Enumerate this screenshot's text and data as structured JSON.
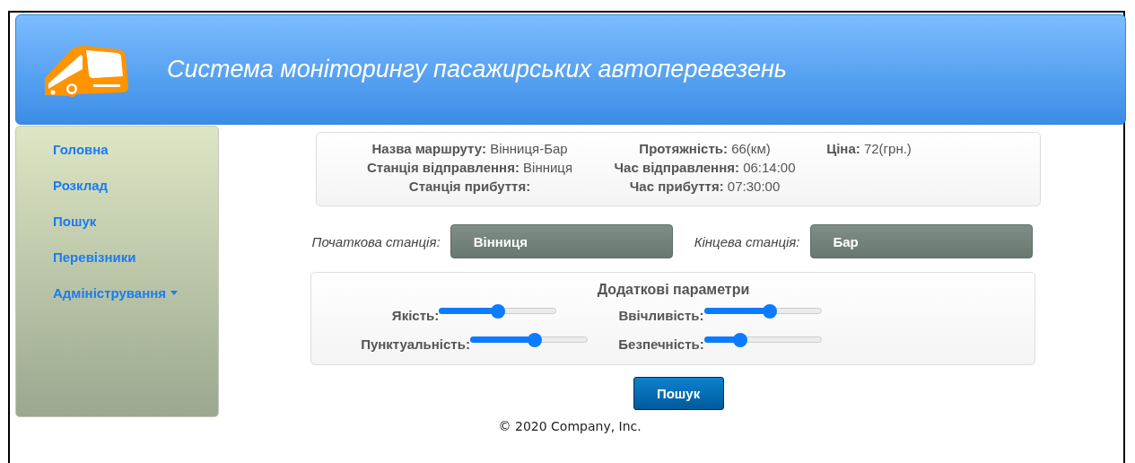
{
  "header": {
    "title": "Система моніторингу пасажирських автоперевезень"
  },
  "sidebar": {
    "items": [
      {
        "label": "Головна",
        "kind": "link"
      },
      {
        "label": "Розклад",
        "kind": "link"
      },
      {
        "label": "Пошук",
        "kind": "link"
      },
      {
        "label": "Перевізники",
        "kind": "link"
      },
      {
        "label": "Адміністрування",
        "kind": "dropdown"
      }
    ]
  },
  "route_info": {
    "rows": [
      [
        "**Назва маршруту:** Вінниця-Бар",
        "**Протяжність:** 66(км)",
        "**Ціна:** 72(грн.)"
      ],
      [
        "**Станція відправлення:** Вінниця",
        "**Час відправлення:** 06:14:00",
        ""
      ],
      [
        "**Станція прибуття:**",
        "**Час прибуття:** 07:30:00",
        ""
      ]
    ]
  },
  "stations": [
    {
      "label": "Початкова станція:",
      "value": "Вінниця"
    },
    {
      "label": "Кінцева станція:",
      "value": "Бар"
    }
  ],
  "parameters": {
    "title": "Додаткові параметри",
    "sliders": [
      {
        "label": "Якість:",
        "level": 0.5
      },
      {
        "label": "Ввічливість:",
        "level": 0.56
      },
      {
        "label": "Пунктуальність:",
        "level": 0.55
      },
      {
        "label": "Безпечність:",
        "level": 0.31
      }
    ]
  },
  "search_button": "Пошук",
  "footer": "© 2020 Company, Inc."
}
